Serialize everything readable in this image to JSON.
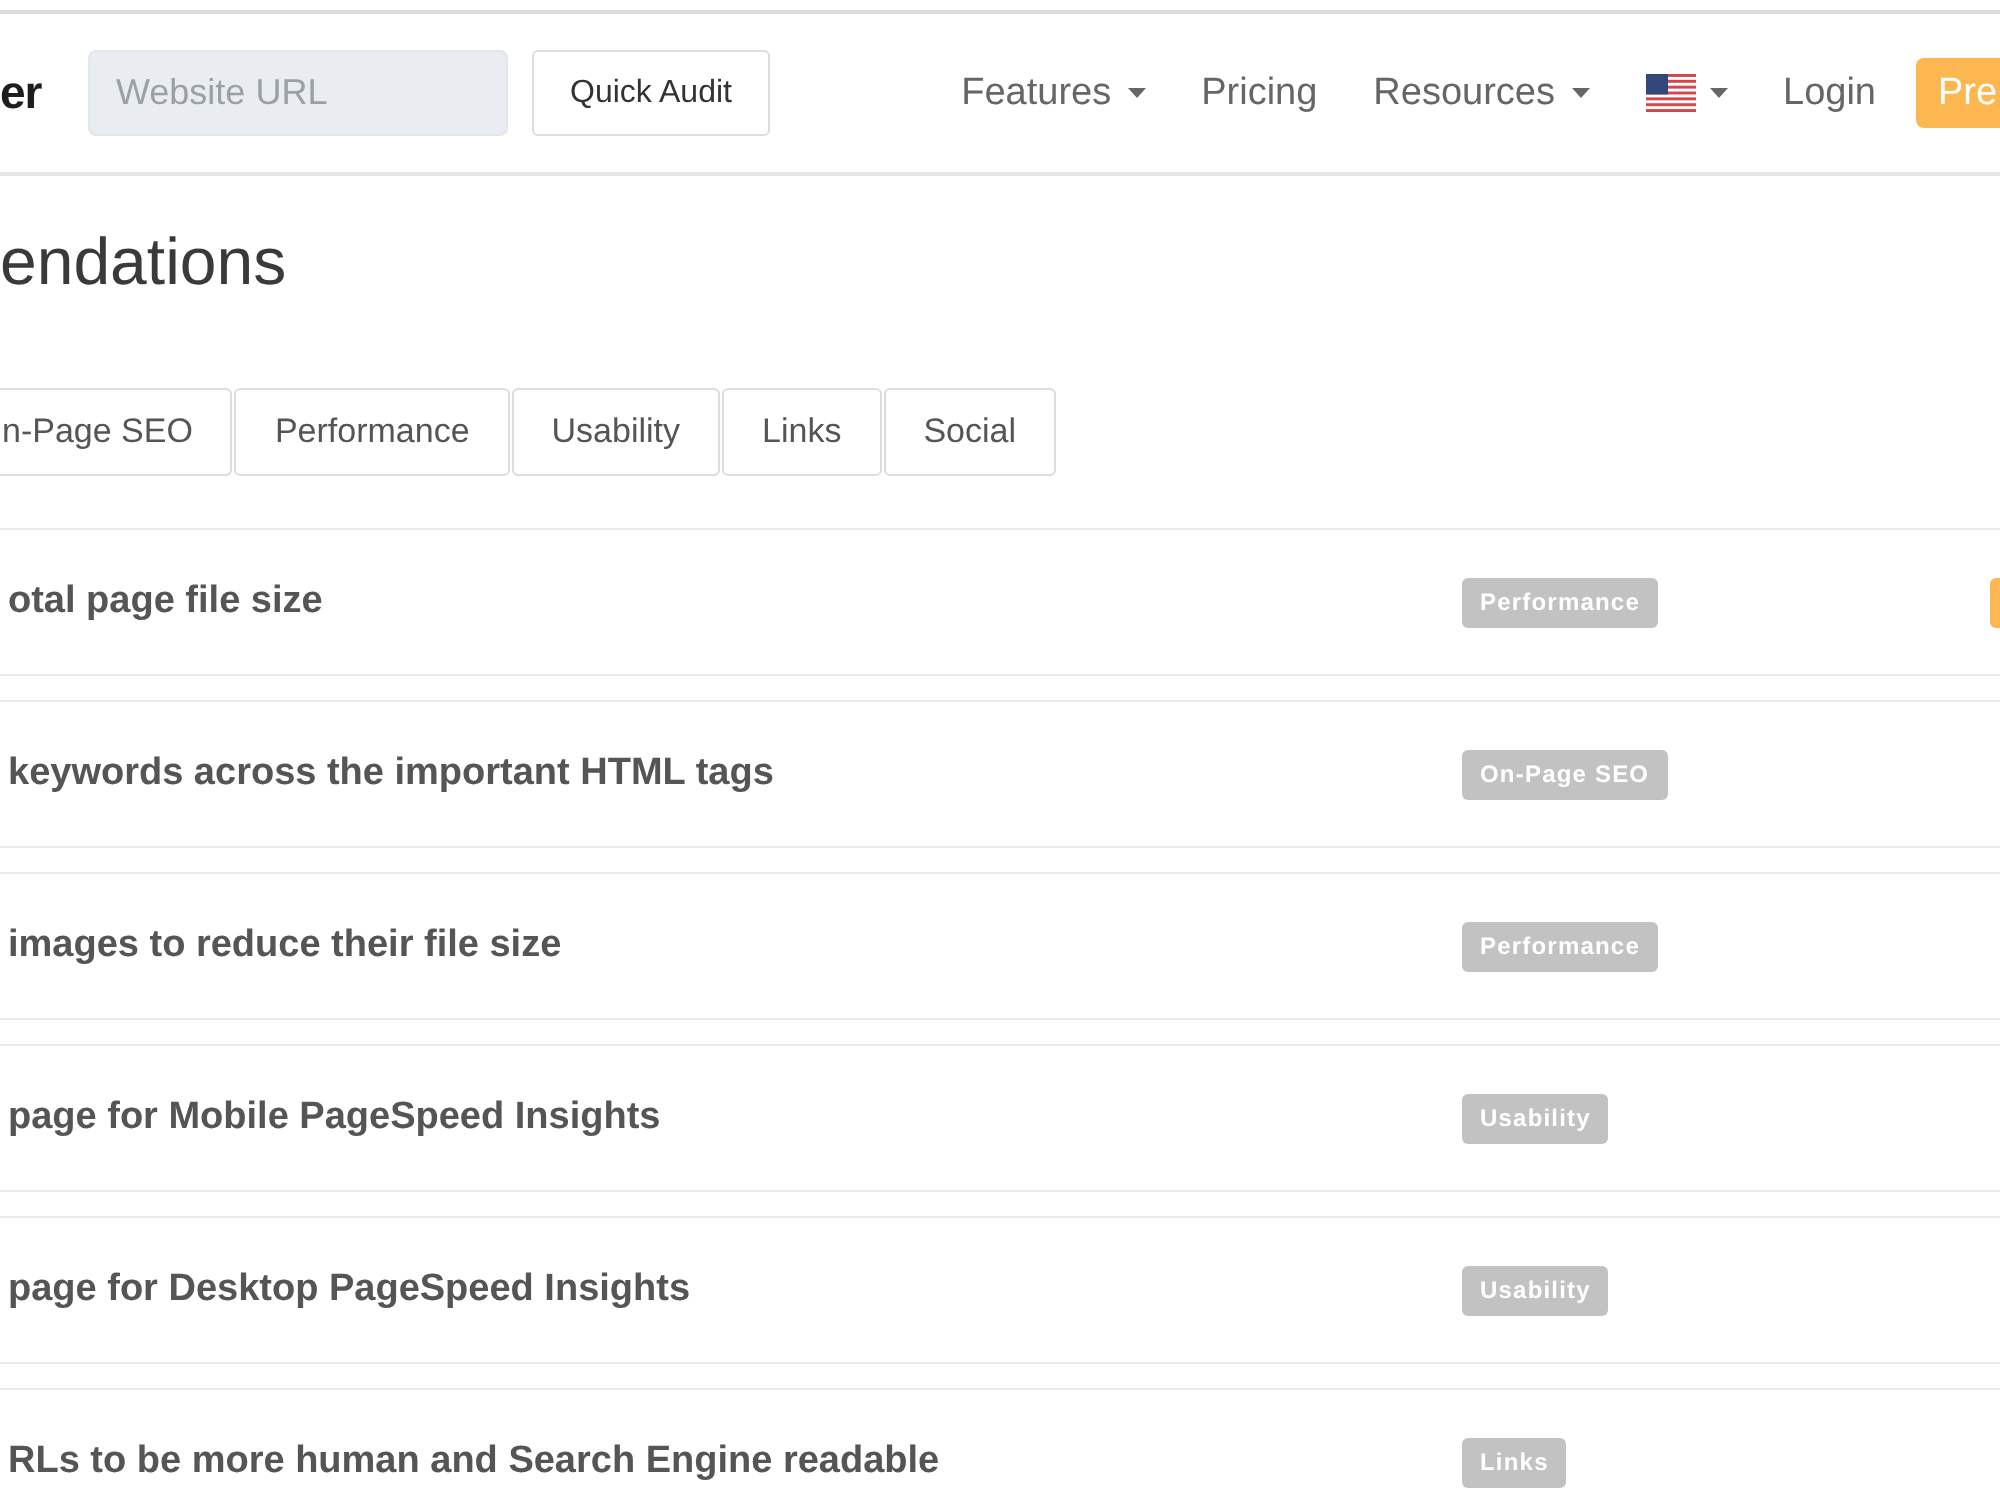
{
  "logo": {
    "text": "er"
  },
  "search": {
    "placeholder": "Website URL"
  },
  "audit_button": {
    "label": "Quick Audit"
  },
  "nav": [
    {
      "kind": "dropdown",
      "label": "Features"
    },
    {
      "kind": "link",
      "label": "Pricing"
    },
    {
      "kind": "dropdown",
      "label": "Resources"
    },
    {
      "kind": "language"
    },
    {
      "kind": "link",
      "label": "Login"
    },
    {
      "kind": "cta",
      "label": "Pre"
    }
  ],
  "page_title": "endations",
  "tabs": [
    {
      "label": "n-Page SEO",
      "selected": false
    },
    {
      "label": "Performance",
      "selected": false
    },
    {
      "label": "Usability",
      "selected": false
    },
    {
      "label": "Links",
      "selected": false
    },
    {
      "label": "Social",
      "selected": false
    }
  ],
  "recommendations": [
    {
      "title": "otal page file size",
      "category": "Performance",
      "priority_badge": true
    },
    {
      "title": "keywords across the important HTML tags",
      "category": "On-Page SEO",
      "priority_badge": false
    },
    {
      "title": "images to reduce their file size",
      "category": "Performance",
      "priority_badge": false
    },
    {
      "title": "page for Mobile PageSpeed Insights",
      "category": "Usability",
      "priority_badge": false
    },
    {
      "title": "page for Desktop PageSpeed Insights",
      "category": "Usability",
      "priority_badge": false
    },
    {
      "title": "RLs to be more human and Search Engine readable",
      "category": "Links",
      "priority_badge": false
    }
  ]
}
